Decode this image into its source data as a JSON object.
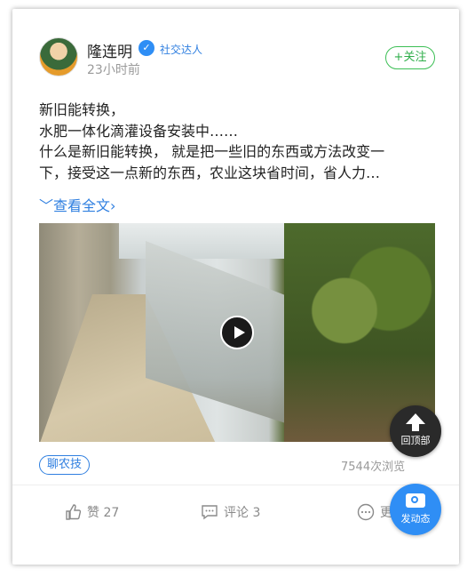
{
  "post": {
    "author_name": "隆连明",
    "author_role": "社交达人",
    "time": "23小时前",
    "follow_label": "+关注",
    "text_lines": [
      "新旧能转换，",
      "水肥一体化滴灌设备安装中……",
      "什么是新旧能转换， 就是把一些旧的东西或方法改变一",
      "下，接受这一点新的东西，农业这块省时间，省人力…"
    ],
    "expand_label": "查看全文",
    "topic_tag": "聊农技",
    "views": "7544次浏览"
  },
  "actions": {
    "like": "赞 27",
    "comment": "评论 3",
    "more": "更"
  },
  "fab": {
    "back_to_top": "回顶部",
    "post_new": "发动态"
  },
  "colors": {
    "accent_blue": "#2f8ef5",
    "follow_green": "#3cbf55"
  }
}
